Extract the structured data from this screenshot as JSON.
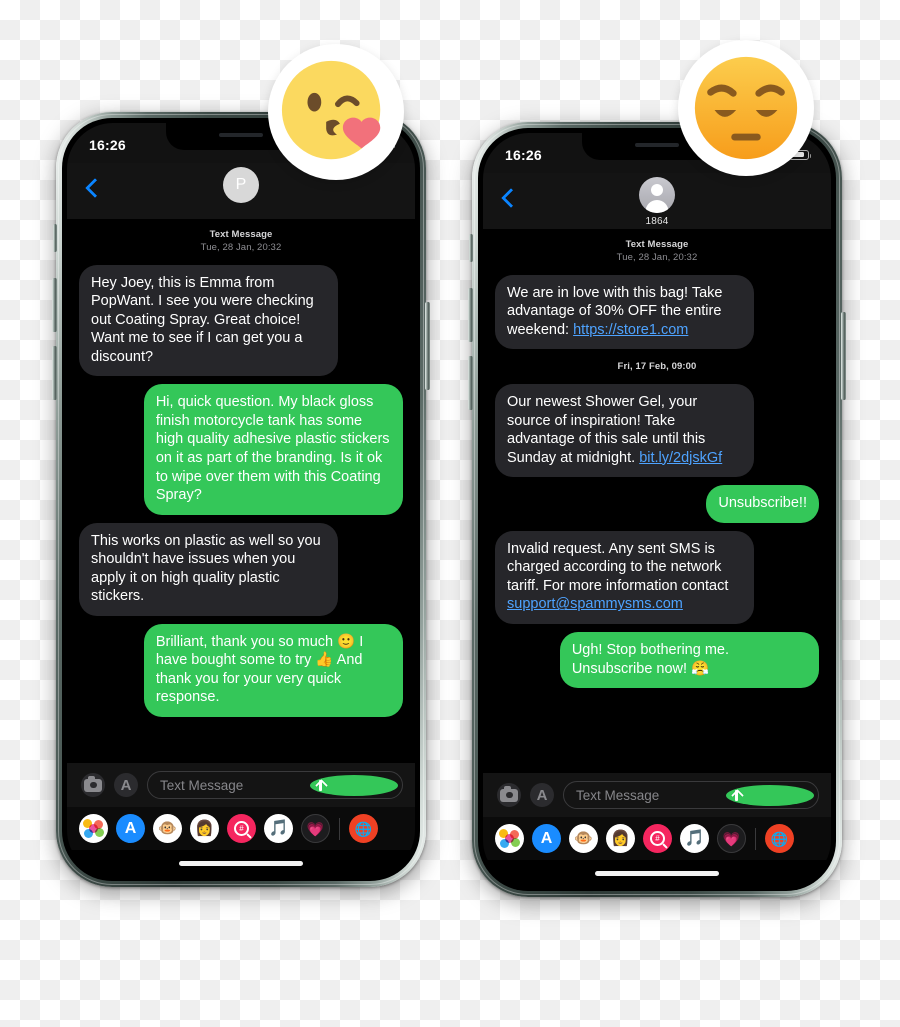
{
  "phones": [
    {
      "id": "left",
      "status": {
        "time": "16:26"
      },
      "header": {
        "back_icon": "chevron-left-icon",
        "avatar_initial": "P",
        "contact_name": ""
      },
      "thread": {
        "daystamp_label": "Text Message",
        "daystamp_date": "Tue, 28 Jan, 20:32",
        "messages": [
          {
            "side": "in",
            "text": "Hey Joey, this is Emma from PopWant. I see you were checking out Coating Spray. Great choice! Want me to see if I can get you a discount?"
          },
          {
            "side": "out",
            "text": "Hi, quick question. My black gloss finish motorcycle tank has some high quality adhesive plastic stickers on it as part of the branding. Is it ok to wipe over them with this Coating Spray?"
          },
          {
            "side": "in",
            "text": "This works on plastic as well so you shouldn't have issues when you apply it on high quality plastic stickers."
          },
          {
            "side": "out",
            "text": "Brilliant, thank you so much 🙂 I have bought some to try 👍 And thank you for your very quick response."
          }
        ]
      },
      "input": {
        "placeholder": "Text Message",
        "camera_icon": "camera-icon",
        "appstore_icon": "app-store-icon",
        "send_icon": "send-arrow-up-icon"
      },
      "sticker": {
        "name": "kissing-heart-emoji",
        "glyph": "😘"
      }
    },
    {
      "id": "right",
      "status": {
        "time": "16:26"
      },
      "header": {
        "back_icon": "chevron-left-icon",
        "avatar_initial": "",
        "contact_name": "1864"
      },
      "thread": {
        "daystamp_label": "Text Message",
        "daystamp_date": "Tue, 28 Jan, 20:32",
        "daystamp_date_2": "Fri, 17 Feb, 09:00",
        "messages": [
          {
            "side": "in",
            "text": "We are in love with this bag! Take advantage of 30% OFF the entire weekend: ",
            "link": "https://store1.com"
          },
          {
            "side": "in",
            "text": "Our newest Shower Gel, your source of inspiration! Take advantage of this sale until this Sunday at midnight. ",
            "link": "bit.ly/2djskGf"
          },
          {
            "side": "out",
            "text": "Unsubscribe!!"
          },
          {
            "side": "in",
            "text": "Invalid request. Any sent SMS is charged according to the network tariff. For more information contact ",
            "link": "support@spammysms.com"
          },
          {
            "side": "out",
            "text": "Ugh! Stop bothering me. Unsubscribe now! 😤"
          }
        ]
      },
      "input": {
        "placeholder": "Text Message",
        "camera_icon": "camera-icon",
        "appstore_icon": "app-store-icon",
        "send_icon": "send-arrow-up-icon"
      },
      "sticker": {
        "name": "pensive-face-emoji",
        "glyph": "😔"
      }
    }
  ],
  "dock": {
    "apps": [
      {
        "name": "photos-app-icon",
        "glyph": ""
      },
      {
        "name": "app-store-app-icon",
        "glyph": "A"
      },
      {
        "name": "animoji-monkey-icon",
        "glyph": "🐵"
      },
      {
        "name": "memoji-person-icon",
        "glyph": "👩"
      },
      {
        "name": "images-search-app-icon",
        "glyph": "#"
      },
      {
        "name": "apple-music-app-icon",
        "glyph": "🎵"
      },
      {
        "name": "digital-touch-app-icon",
        "glyph": "💗"
      },
      {
        "name": "more-apps-icon",
        "glyph": "🌐"
      }
    ]
  },
  "colors": {
    "bubble_incoming": "#26262a",
    "bubble_outgoing": "#34c759",
    "link": "#4ea3ff",
    "accent_blue": "#0a84ff",
    "screen_background": "#000000",
    "chrome": "#141414"
  }
}
